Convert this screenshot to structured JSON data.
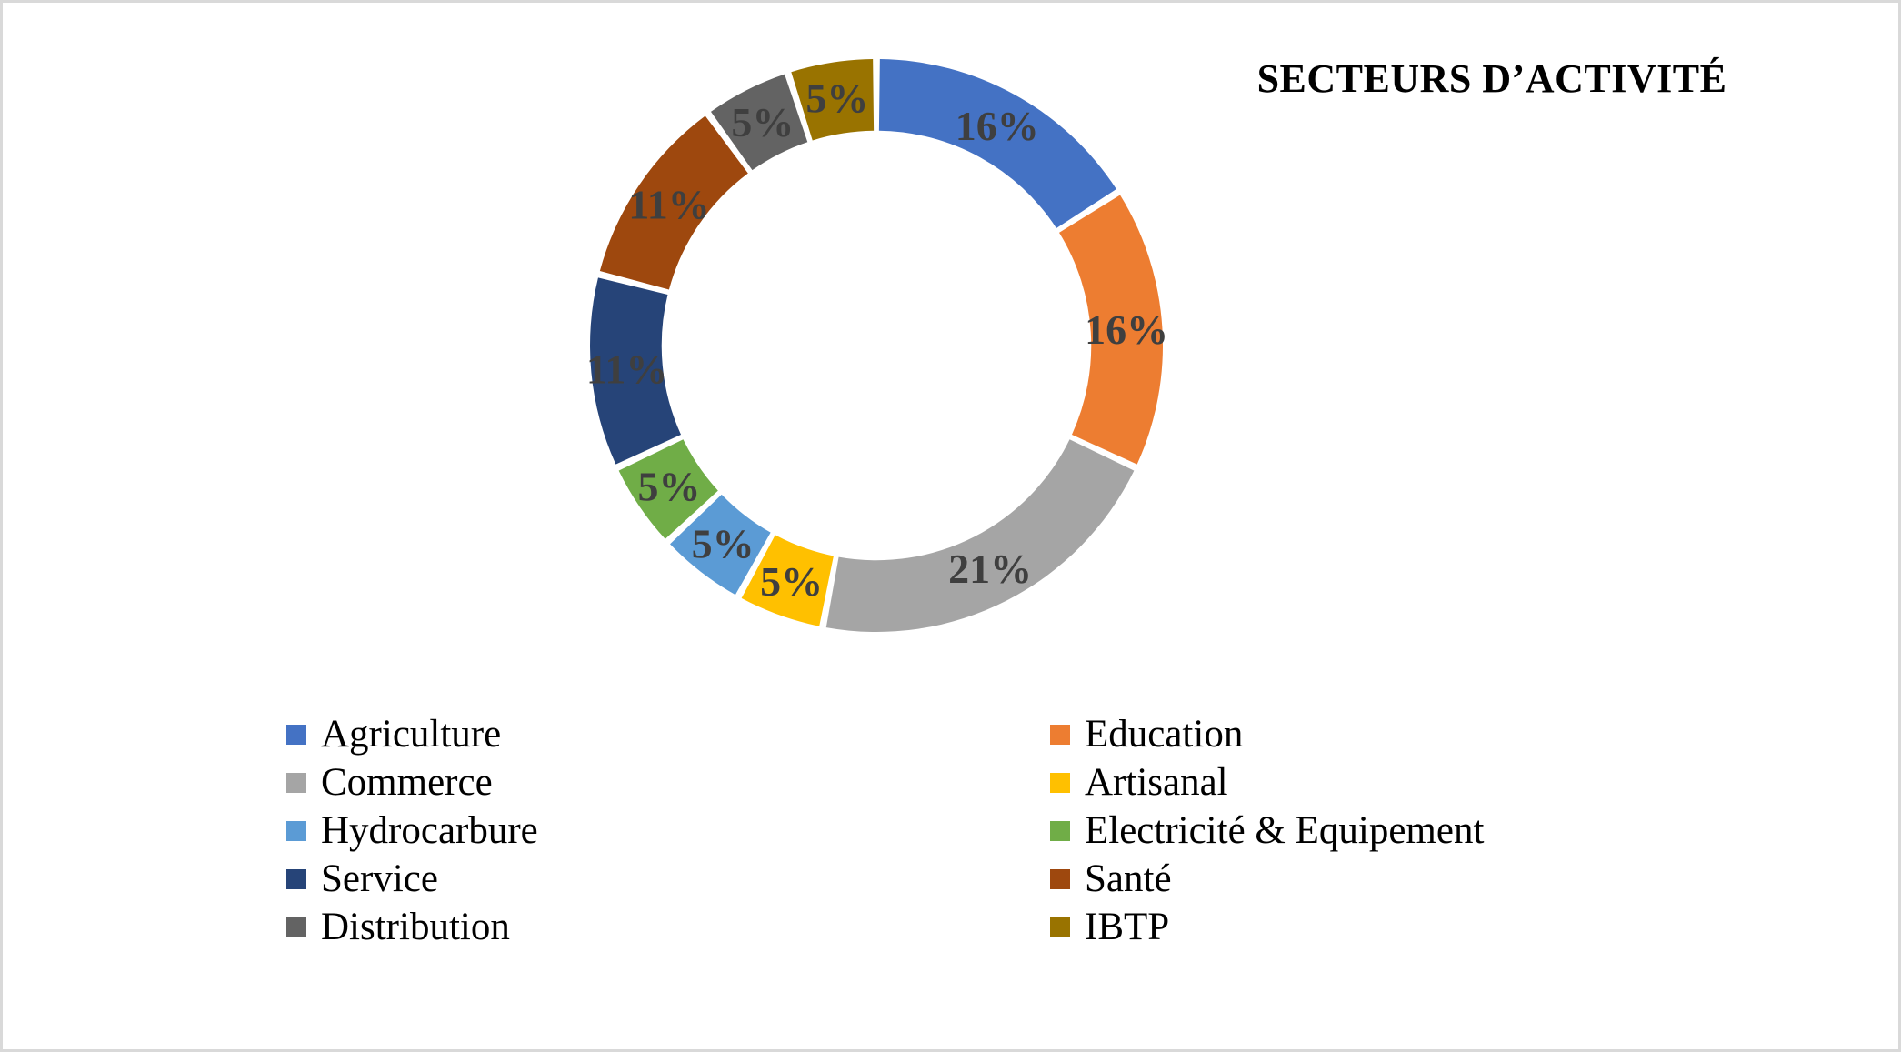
{
  "chart": {
    "title": "SECTEURS D’ACTIVITÉ"
  },
  "chart_data": {
    "type": "pie",
    "variant": "doughnut",
    "title": "SECTEURS D’ACTIVITÉ",
    "unit": "%",
    "legend_position": "bottom",
    "legend_columns": 2,
    "start_angle_deg": 0,
    "direction": "clockwise",
    "inner_radius_ratio": 0.75,
    "categories": [
      "Agriculture",
      "Education",
      "Commerce",
      "Artisanal",
      "Hydrocarbure",
      "Electricité & Equipement",
      "Service",
      "Santé",
      "Distribution",
      "IBTP"
    ],
    "values": [
      16,
      16,
      21,
      5,
      5,
      5,
      11,
      11,
      5,
      5
    ],
    "labels": [
      "16%",
      "16%",
      "21%",
      "5%",
      "5%",
      "5%",
      "11%",
      "11%",
      "5%",
      "5%"
    ],
    "colors": [
      "#4472C4",
      "#ED7D31",
      "#A5A5A5",
      "#FFC000",
      "#5B9BD5",
      "#70AD47",
      "#264478",
      "#9E480E",
      "#636363",
      "#997300"
    ],
    "slices": [
      {
        "name": "Agriculture",
        "value": 16,
        "label": "16%",
        "color": "#4472C4"
      },
      {
        "name": "Education",
        "value": 16,
        "label": "16%",
        "color": "#ED7D31"
      },
      {
        "name": "Commerce",
        "value": 21,
        "label": "21%",
        "color": "#A5A5A5"
      },
      {
        "name": "Artisanal",
        "value": 5,
        "label": "5%",
        "color": "#FFC000"
      },
      {
        "name": "Hydrocarbure",
        "value": 5,
        "label": "5%",
        "color": "#5B9BD5"
      },
      {
        "name": "Electricité & Equipement",
        "value": 5,
        "label": "5%",
        "color": "#70AD47"
      },
      {
        "name": "Service",
        "value": 11,
        "label": "11%",
        "color": "#264478"
      },
      {
        "name": "Santé",
        "value": 11,
        "label": "11%",
        "color": "#9E480E"
      },
      {
        "name": "Distribution",
        "value": 5,
        "label": "5%",
        "color": "#636363"
      },
      {
        "name": "IBTP",
        "value": 5,
        "label": "5%",
        "color": "#997300"
      }
    ],
    "label_color": "#3f3f3f"
  },
  "legend": {
    "items": [
      {
        "label": "Agriculture",
        "color": "#4472C4"
      },
      {
        "label": "Education",
        "color": "#ED7D31"
      },
      {
        "label": "Commerce",
        "color": "#A5A5A5"
      },
      {
        "label": "Artisanal",
        "color": "#FFC000"
      },
      {
        "label": "Hydrocarbure",
        "color": "#5B9BD5"
      },
      {
        "label": "Electricité & Equipement",
        "color": "#70AD47"
      },
      {
        "label": "Service",
        "color": "#264478"
      },
      {
        "label": "Santé",
        "color": "#9E480E"
      },
      {
        "label": "Distribution",
        "color": "#636363"
      },
      {
        "label": "IBTP",
        "color": "#997300"
      }
    ]
  },
  "style": {
    "frame_border_color": "#d9d9d9",
    "background": "#ffffff"
  }
}
